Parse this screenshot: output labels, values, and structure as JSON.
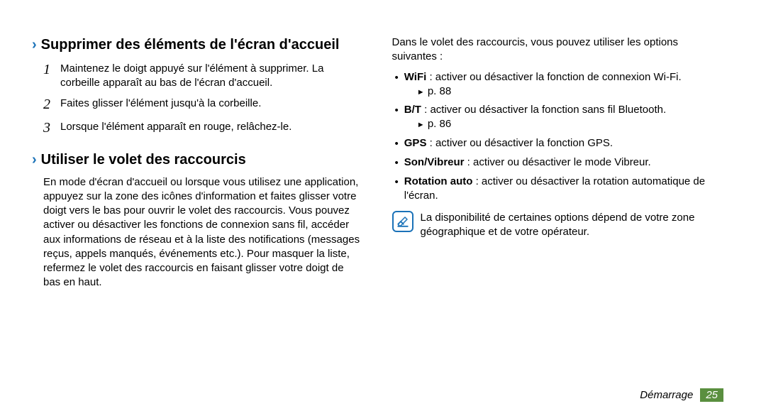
{
  "left": {
    "section1": {
      "title": "Supprimer des éléments de l'écran d'accueil",
      "steps": [
        {
          "num": "1",
          "text": "Maintenez le doigt appuyé sur l'élément à supprimer. La corbeille apparaît au bas de l'écran d'accueil."
        },
        {
          "num": "2",
          "text": "Faites glisser l'élément jusqu'à la corbeille."
        },
        {
          "num": "3",
          "text": "Lorsque l'élément apparaît en rouge, relâchez-le."
        }
      ]
    },
    "section2": {
      "title": "Utiliser le volet des raccourcis",
      "para": "En mode d'écran d'accueil ou lorsque vous utilisez une application, appuyez sur la zone des icônes d'information et faites glisser votre doigt vers le bas pour ouvrir le volet des raccourcis. Vous pouvez activer ou désactiver les fonctions de connexion sans fil, accéder aux informations de réseau et à la liste des notifications (messages reçus, appels manqués, événements etc.). Pour masquer la liste, refermez le volet des raccourcis en faisant glisser votre doigt de bas en haut."
    }
  },
  "right": {
    "intro": "Dans le volet des raccourcis, vous pouvez utiliser les options suivantes :",
    "items": [
      {
        "bold": "WiFi",
        "rest": " : activer ou désactiver la fonction de connexion Wi-Fi.",
        "ref": "p. 88"
      },
      {
        "bold": "B/T",
        "rest": " : activer ou désactiver la fonction sans fil Bluetooth.",
        "ref": "p. 86"
      },
      {
        "bold": "GPS",
        "rest": " : activer ou désactiver la fonction GPS."
      },
      {
        "bold": "Son/Vibreur",
        "rest": " : activer ou désactiver le mode Vibreur."
      },
      {
        "bold": "Rotation auto",
        "rest": " : activer ou désactiver la rotation automatique de l'écran."
      }
    ],
    "note": "La disponibilité de certaines options dépend de votre zone géographique et de votre opérateur."
  },
  "footer": {
    "label": "Démarrage",
    "page": "25"
  }
}
